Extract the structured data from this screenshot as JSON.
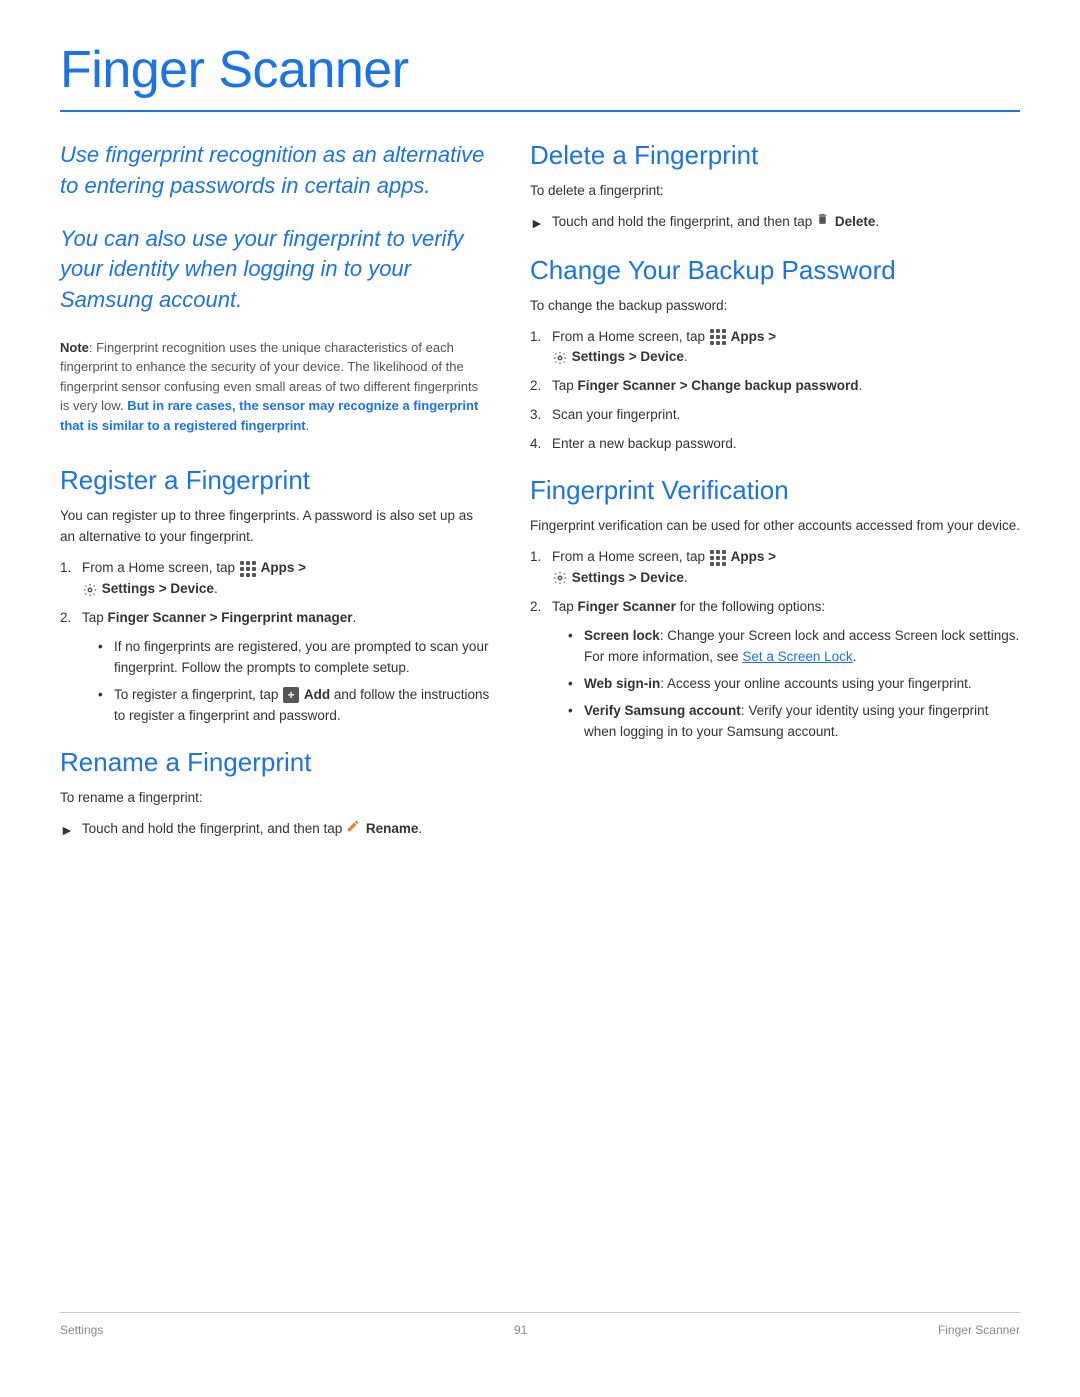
{
  "page": {
    "title": "Finger Scanner",
    "footer": {
      "left": "Settings",
      "page": "91",
      "right": "Finger Scanner"
    }
  },
  "left": {
    "intro1": "Use fingerprint recognition as an alternative to entering passwords in certain apps.",
    "intro2": "You can also use your fingerprint to verify your identity when logging in to your Samsung account.",
    "note_label": "Note",
    "note_text": ": Fingerprint recognition uses the unique characteristics of each fingerprint to enhance the security of your device. The likelihood of the fingerprint sensor confusing even small areas of two different fingerprints is very low. ",
    "note_highlight": "But in rare cases, the sensor may recognize a fingerprint that is similar to a registered fingerprint",
    "note_end": ".",
    "register_heading": "Register a Fingerprint",
    "register_intro": "You can register up to three fingerprints. A password is also set up as an alternative to your fingerprint.",
    "step1_register": "From a Home screen, tap",
    "apps_label": "Apps >",
    "settings_label": "Settings > Device",
    "step2_register": "Tap",
    "step2_bold": "Finger Scanner > Fingerprint manager",
    "step2_end": ".",
    "bullet1": "If no fingerprints are registered, you are prompted to scan your fingerprint. Follow the prompts to complete setup.",
    "bullet2_pre": "To register a fingerprint, tap",
    "bullet2_add": "Add",
    "bullet2_end": "and follow the instructions to register a fingerprint and password.",
    "rename_heading": "Rename a Fingerprint",
    "rename_intro": "To rename a fingerprint:",
    "rename_arrow": "Touch and hold the fingerprint, and then tap",
    "rename_bold": "Rename",
    "rename_end": "."
  },
  "right": {
    "delete_heading": "Delete a Fingerprint",
    "delete_intro": "To delete a fingerprint:",
    "delete_arrow": "Touch and hold the fingerprint, and then tap",
    "delete_bold": "Delete",
    "delete_end": ".",
    "backup_heading": "Change Your Backup Password",
    "backup_intro": "To change the backup password:",
    "backup_step1": "From a Home screen, tap",
    "backup_apps": "Apps >",
    "backup_settings": "Settings > Device",
    "backup_step2": "Tap",
    "backup_step2_bold": "Finger Scanner > Change backup password",
    "backup_step2_end": ".",
    "backup_step3": "Scan your fingerprint.",
    "backup_step4": "Enter a new backup password.",
    "verify_heading": "Fingerprint Verification",
    "verify_intro": "Fingerprint verification can be used for other accounts accessed from your device.",
    "verify_step1": "From a Home screen, tap",
    "verify_apps": "Apps >",
    "verify_settings": "Settings > Device",
    "verify_step2": "Tap",
    "verify_step2_bold": "Finger Scanner",
    "verify_step2_end": " for the following options:",
    "bullet_screen_label": "Screen lock",
    "bullet_screen_text": ": Change your Screen lock and access Screen lock settings. For more information, see ",
    "bullet_screen_link": "Set a Screen Lock",
    "bullet_screen_end": ".",
    "bullet_web_label": "Web sign-in",
    "bullet_web_text": ": Access your online accounts using your fingerprint.",
    "bullet_verify_label": "Verify Samsung account",
    "bullet_verify_text": ": Verify your identity using your fingerprint when logging in to your Samsung account."
  }
}
